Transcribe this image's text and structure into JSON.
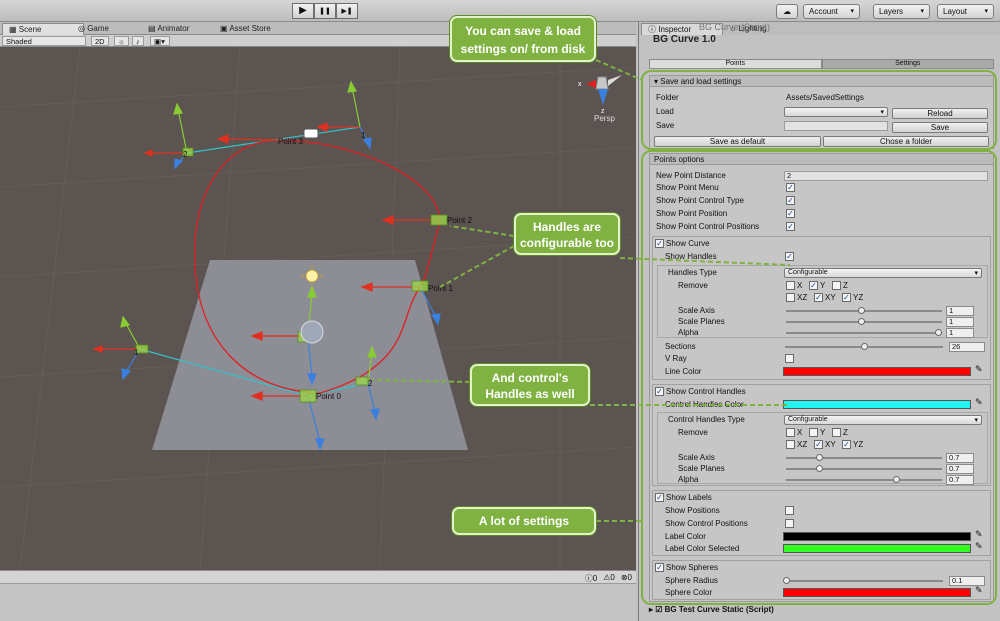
{
  "toolbar": {
    "play_icon": "play-icon",
    "pause_icon": "pause-icon",
    "step_icon": "step-icon",
    "play_glyph": "▶",
    "pause_glyph": "❚❚",
    "step_glyph": "▶❚",
    "cloud_glyph": "☁",
    "account_label": "Account",
    "layers_label": "Layers",
    "layout_label": "Layout"
  },
  "scene": {
    "tabs": [
      "Scene",
      "Game",
      "Animator",
      "Asset Store"
    ],
    "shading_mode": "Shaded",
    "mode_2d": "2D",
    "persp_label": "Persp",
    "gizmo_x": "x",
    "gizmo_z": "z",
    "point_labels": [
      "Point 3",
      "Point 2",
      "Point 1",
      "Point 0",
      "1",
      "2",
      "1",
      "2"
    ]
  },
  "console": {
    "counts": [
      "0",
      "0",
      "0"
    ]
  },
  "inspector": {
    "tabs": [
      "Inspector",
      "Lighting"
    ],
    "component_header": "BG Curve (Script)",
    "component_title": "BG Curve 1.0",
    "editor_tabs": [
      "Points",
      "Settings"
    ],
    "footer_component": "BG Test Curve Static (Script)",
    "save_load": {
      "header": "Save and load settings",
      "folder_label": "Folder",
      "folder_value": "Assets/SavedSettings",
      "load_label": "Load",
      "reload_button": "Reload",
      "save_label": "Save",
      "save_button": "Save",
      "save_default_button": "Save as default",
      "choose_folder_button": "Chose a folder"
    },
    "points_options": {
      "header": "Points options",
      "new_point_distance_label": "New Point Distance",
      "new_point_distance_value": "2",
      "show_point_menu": "Show Point Menu",
      "show_point_control_type": "Show Point Control Type",
      "show_point_position": "Show Point Position",
      "show_point_control_positions": "Show Point Control Positions"
    },
    "curve": {
      "show_curve": "Show Curve",
      "show_handles": "Show Handles",
      "handles_type_label": "Handles Type",
      "handles_type_value": "Configurable",
      "remove_label": "Remove",
      "axes_row1": [
        "X",
        "Y",
        "Z"
      ],
      "axes_row2": [
        "XZ",
        "XY",
        "YZ"
      ],
      "scale_axis_label": "Scale Axis",
      "scale_axis_value": "1",
      "scale_planes_label": "Scale Planes",
      "scale_planes_value": "1",
      "alpha_label": "Alpha",
      "alpha_value": "1",
      "sections_label": "Sections",
      "sections_value": "26",
      "vray_label": "V Ray",
      "line_color_label": "Line Color",
      "line_color": "#ff0000"
    },
    "control_handles": {
      "show_control_handles": "Show Control Handles",
      "color_label": "Control Handles Color",
      "color": "#22f4f4",
      "type_label": "Control Handles Type",
      "type_value": "Configurable",
      "remove_label": "Remove",
      "axes_row1": [
        "X",
        "Y",
        "Z"
      ],
      "axes_row2": [
        "XZ",
        "XY",
        "YZ"
      ],
      "scale_axis_label": "Scale Axis",
      "scale_axis_value": "0.7",
      "scale_planes_label": "Scale Planes",
      "scale_planes_value": "0.7",
      "alpha_label": "Alpha",
      "alpha_value": "0.7"
    },
    "labels": {
      "show_labels": "Show Labels",
      "show_positions": "Show Positions",
      "show_control_positions": "Show Control Positions",
      "label_color_label": "Label Color",
      "label_color": "#000000",
      "label_color_selected_label": "Label Color Selected",
      "label_color_selected": "#33ff22"
    },
    "spheres": {
      "show_spheres": "Show Spheres",
      "sphere_radius_label": "Sphere Radius",
      "sphere_radius_value": "0.1",
      "sphere_color_label": "Sphere Color",
      "sphere_color": "#ff0000"
    }
  },
  "callouts": {
    "save_load": "You can save & load settings on/ from disk",
    "handles": "Handles are configurable too",
    "control_handles": "And control's Handles as well",
    "settings": "A lot of settings"
  },
  "colors": {
    "callout_green": "#7fb241",
    "curve_red": "#e02020",
    "viewport": "#5c5450"
  }
}
